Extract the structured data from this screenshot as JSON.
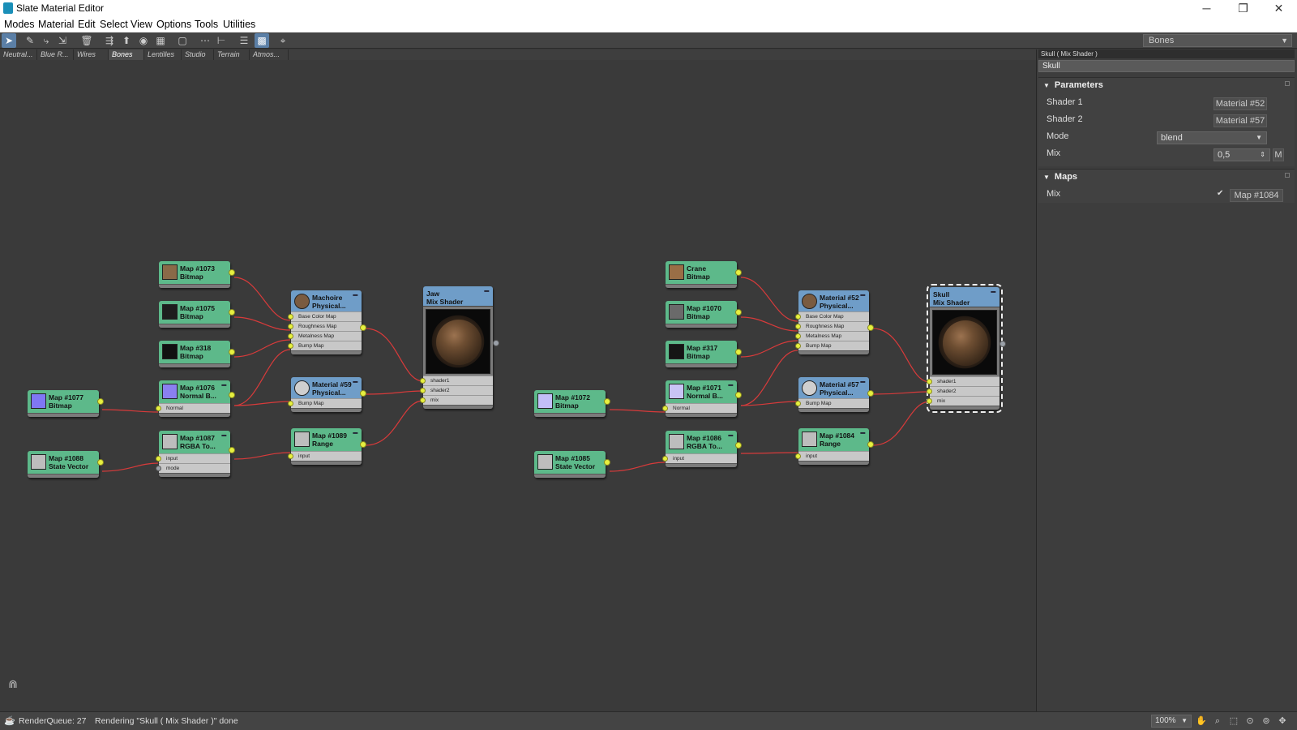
{
  "window": {
    "title": "Slate Material Editor"
  },
  "menu": [
    "Modes",
    "Material",
    "Edit",
    "Select",
    "View",
    "Options",
    "Tools",
    "Utilities"
  ],
  "toolbar": {
    "view_dropdown": "Bones"
  },
  "tabs": [
    "Neutral...",
    "Blue R...",
    "Wires",
    "Bones",
    "Lentilles",
    "Studio",
    "Terrain",
    "Atmos..."
  ],
  "selected_tab": "Bones",
  "nodes": {
    "m1073": {
      "title": "Map #1073",
      "type": "Bitmap"
    },
    "m1075": {
      "title": "Map #1075",
      "type": "Bitmap"
    },
    "m318": {
      "title": "Map #318",
      "type": "Bitmap"
    },
    "m1076": {
      "title": "Map #1076",
      "type": "Normal B...",
      "slots": [
        "Normal"
      ]
    },
    "m1077": {
      "title": "Map #1077",
      "type": "Bitmap"
    },
    "m1088": {
      "title": "Map #1088",
      "type": "State Vector"
    },
    "m1087": {
      "title": "Map #1087",
      "type": "RGBA To...",
      "slots": [
        "input",
        "mode"
      ]
    },
    "machoire": {
      "title": "Machoire",
      "type": "Physical...",
      "slots": [
        "Base Color Map",
        "Roughness Map",
        "Metalness Map",
        "Bump Map"
      ]
    },
    "mat59": {
      "title": "Material #59",
      "type": "Physical...",
      "slots": [
        "Bump Map"
      ]
    },
    "m1089": {
      "title": "Map #1089",
      "type": "Range",
      "slots": [
        "input"
      ]
    },
    "jaw": {
      "title": "Jaw",
      "type": "Mix Shader",
      "slots": [
        "shader1",
        "shader2",
        "mix"
      ]
    },
    "crane": {
      "title": "Crane",
      "type": "Bitmap"
    },
    "m1070": {
      "title": "Map #1070",
      "type": "Bitmap"
    },
    "m317": {
      "title": "Map #317",
      "type": "Bitmap"
    },
    "m1071": {
      "title": "Map #1071",
      "type": "Normal B...",
      "slots": [
        "Normal"
      ]
    },
    "m1072": {
      "title": "Map #1072",
      "type": "Bitmap"
    },
    "m1085": {
      "title": "Map #1085",
      "type": "State Vector"
    },
    "m1086": {
      "title": "Map #1086",
      "type": "RGBA To...",
      "slots": [
        "input"
      ]
    },
    "mat52": {
      "title": "Material #52",
      "type": "Physical...",
      "slots": [
        "Base Color Map",
        "Roughness Map",
        "Metalness Map",
        "Bump Map"
      ]
    },
    "mat57": {
      "title": "Material #57",
      "type": "Physical...",
      "slots": [
        "Bump Map"
      ]
    },
    "m1084": {
      "title": "Map #1084",
      "type": "Range",
      "slots": [
        "input"
      ]
    },
    "skull": {
      "title": "Skull",
      "type": "Mix Shader",
      "slots": [
        "shader1",
        "shader2",
        "mix"
      ]
    }
  },
  "panel": {
    "header": "Skull  ( Mix Shader )",
    "name": "Skull",
    "parameters": {
      "title": "Parameters",
      "shader1_label": "Shader 1",
      "shader1_value": "Material #52",
      "shader2_label": "Shader 2",
      "shader2_value": "Material #57",
      "mode_label": "Mode",
      "mode_value": "blend",
      "mix_label": "Mix",
      "mix_value": "0,5",
      "mix_btn": "M"
    },
    "maps": {
      "title": "Maps",
      "mix_label": "Mix",
      "mix_checked": "✔",
      "mix_map": "Map #1084"
    }
  },
  "status": {
    "render_queue": "RenderQueue: 27",
    "message": "Rendering \"Skull  ( Mix Shader )\" done",
    "zoom": "100%"
  },
  "colors": {
    "map_node": "#5db98a",
    "material_node": "#6f9dc8",
    "wire": "#d83a3a",
    "pin": "#e6f040"
  }
}
